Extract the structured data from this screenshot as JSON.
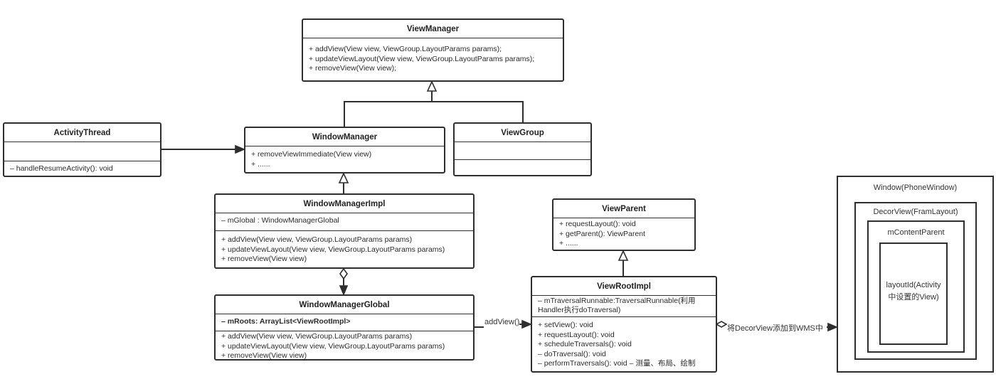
{
  "classes": {
    "view_manager": {
      "name": "ViewManager",
      "methods": [
        "+ addView(View view, ViewGroup.LayoutParams params);",
        "+ updateViewLayout(View view, ViewGroup.LayoutParams params);",
        "+ removeView(View view);"
      ]
    },
    "activity_thread": {
      "name": "ActivityThread",
      "methods": [
        "– handleResumeActivity(): void"
      ]
    },
    "window_manager": {
      "name": "WindowManager",
      "methods": [
        "+ removeViewImmediate(View view)",
        "+ ......"
      ]
    },
    "view_group": {
      "name": "ViewGroup"
    },
    "window_manager_impl": {
      "name": "WindowManagerImpl",
      "fields": [
        "– mGlobal : WindowManagerGlobal"
      ],
      "methods": [
        "+ addView(View view, ViewGroup.LayoutParams params)",
        "+ updateViewLayout(View view,  ViewGroup.LayoutParams params)",
        "+ removeView(View view)"
      ]
    },
    "window_manager_global": {
      "name": "WindowManagerGlobal",
      "fields": [
        "– mRoots: ArrayList<ViewRootImpl>"
      ],
      "methods": [
        "+ addView(View view, ViewGroup.LayoutParams params)",
        "+ updateViewLayout(View view,  ViewGroup.LayoutParams params)",
        "+ removeView(View view)"
      ]
    },
    "view_parent": {
      "name": "ViewParent",
      "methods": [
        "+ requestLayout(): void",
        "+ getParent(): ViewParent",
        "+ ......"
      ]
    },
    "view_root_impl": {
      "name": "ViewRootImpl",
      "fields": [
        "– mTraversalRunnable:TraversalRunnable(利用",
        "Handler执行doTraversal)"
      ],
      "methods": [
        "+ setView(): void",
        "+ requestLayout(): void",
        "+ scheduleTraversals(): void",
        "– doTraversal(): void",
        "– performTraversals(): void – 测量、布局、绘制"
      ]
    }
  },
  "edges": {
    "add_view_label": "addView()",
    "decor_view_label": "将DecorView添加到WMS中"
  },
  "window_hierarchy": {
    "window": "Window(PhoneWindow)",
    "decor_view": "DecorView(FramLayout)",
    "content_parent": "mContentParent",
    "layout_id_line1": "layoutId(Activity",
    "layout_id_line2": "中设置的View)"
  }
}
